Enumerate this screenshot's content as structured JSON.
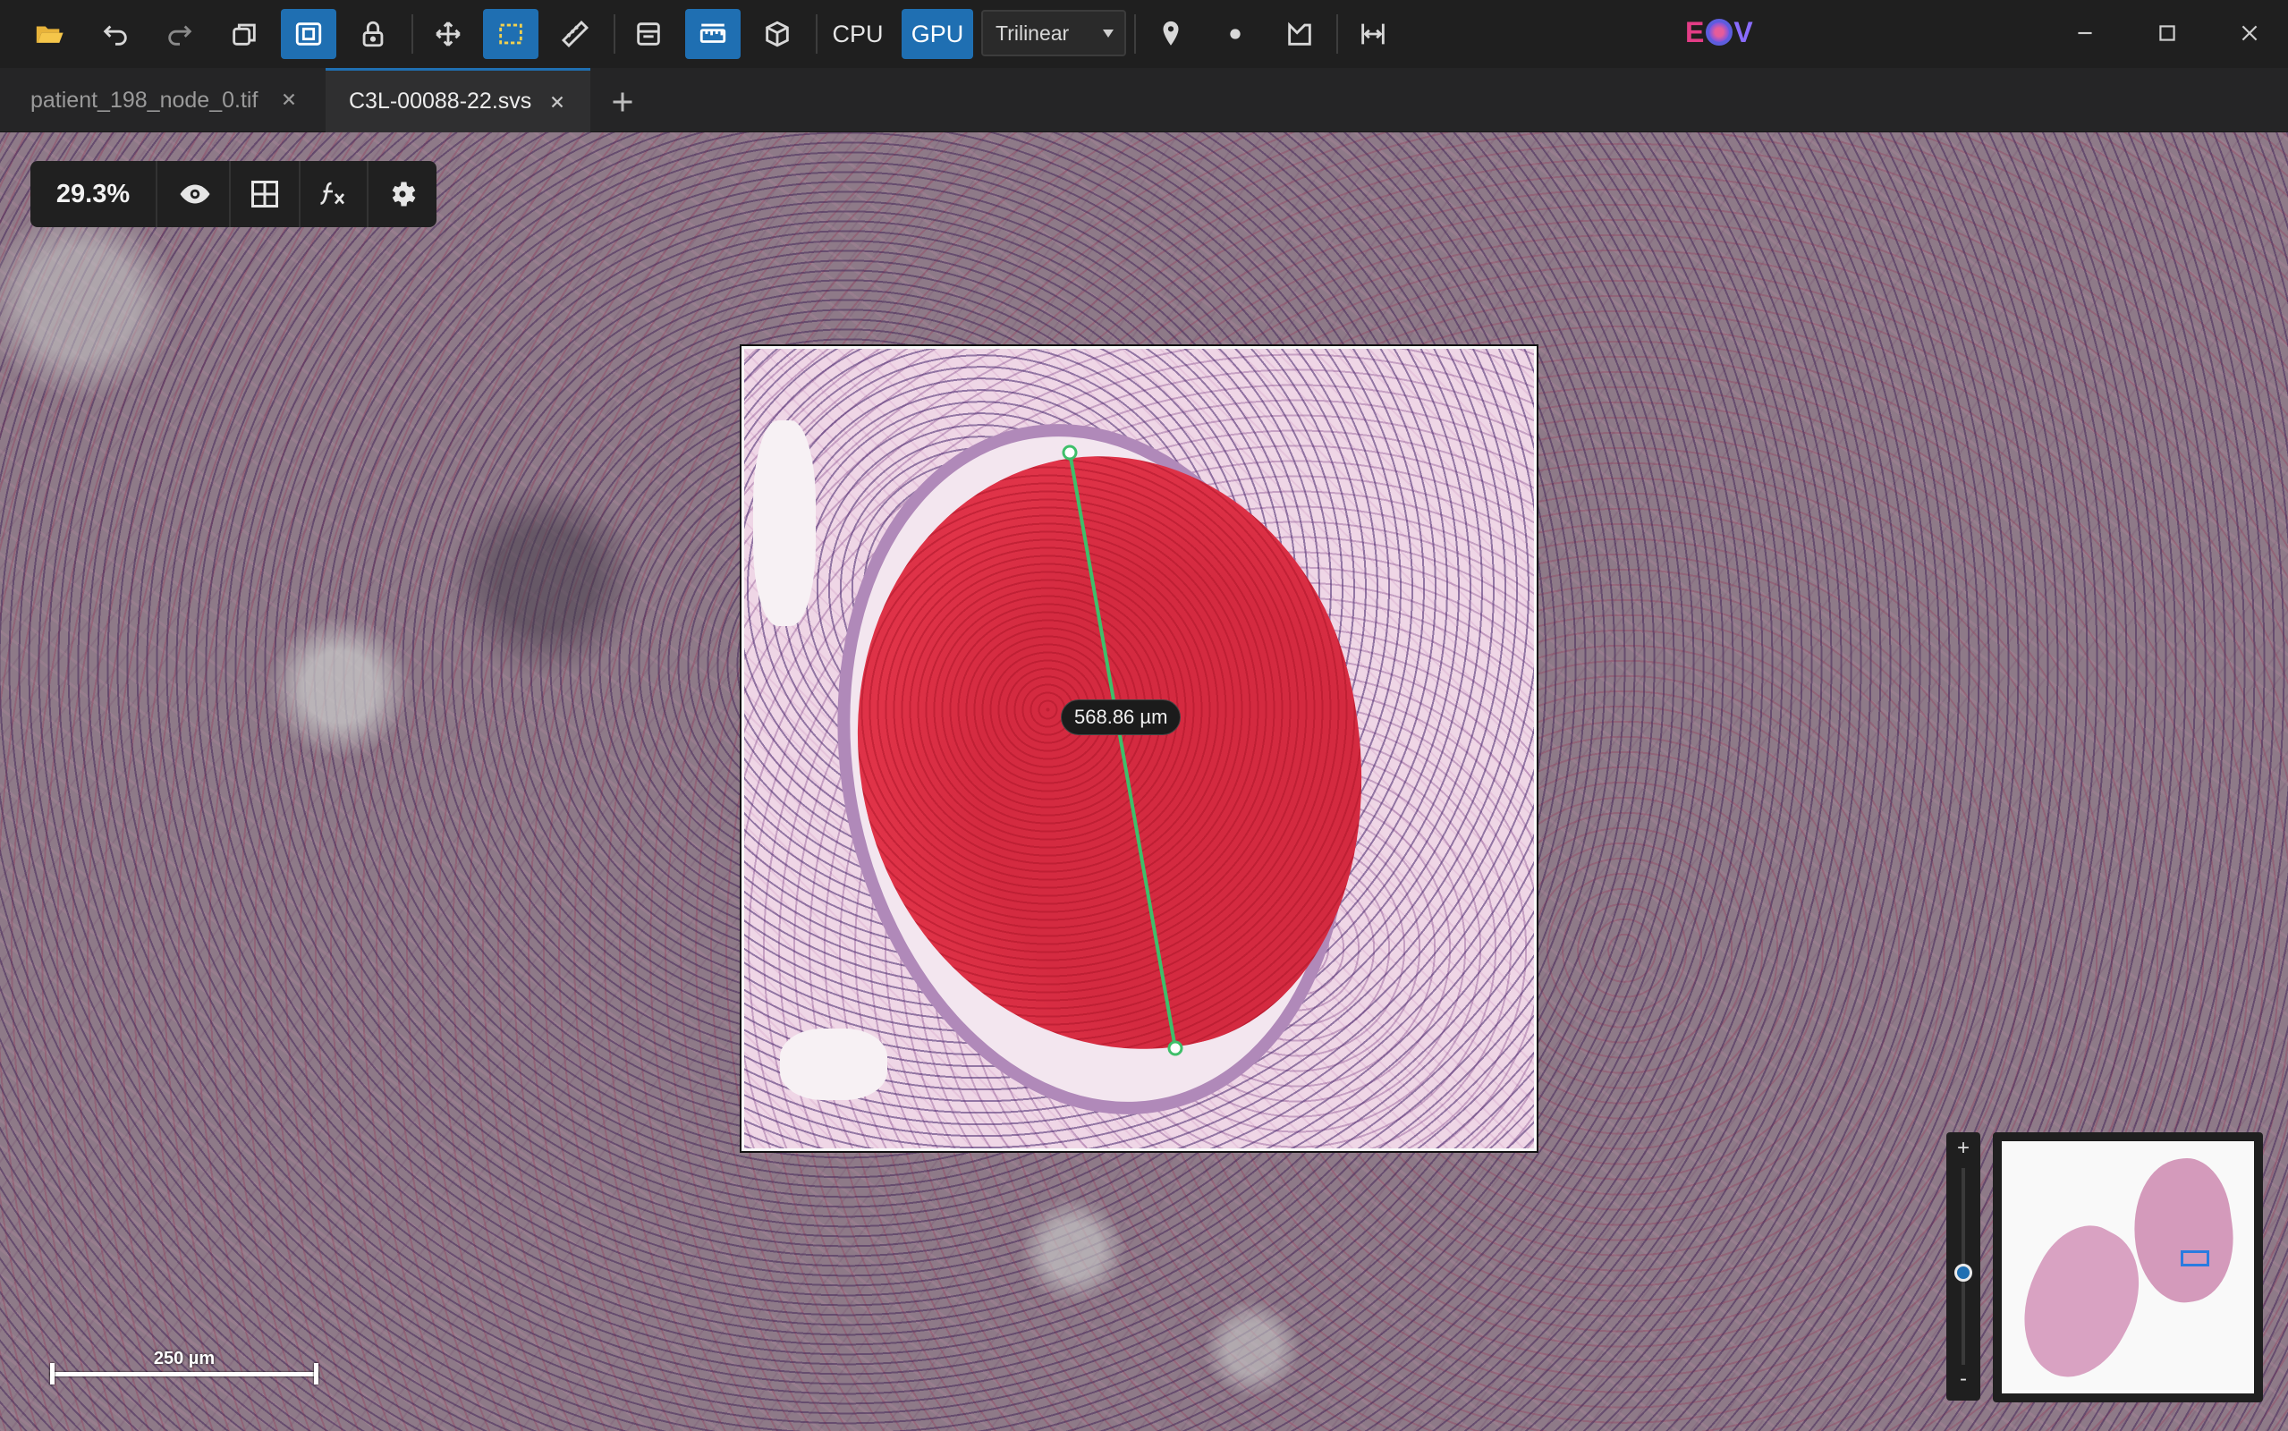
{
  "toolbar": {
    "icons": [
      "folder-open-icon",
      "undo-icon",
      "redo-icon",
      "layers-icon",
      "panel-toggle-icon",
      "lock-icon",
      "move-icon",
      "rectangle-select-icon",
      "ruler-icon",
      "annotation-panel-icon",
      "measure-window-icon",
      "cube-icon",
      "marker-pin-icon",
      "dot-icon",
      "polygon-icon",
      "compare-icon"
    ],
    "cpu_label": "CPU",
    "gpu_label": "GPU",
    "interpolation": "Trilinear",
    "active_color": "#1f6fb2"
  },
  "app": {
    "logo": "EOV"
  },
  "tabs": [
    {
      "label": "patient_198_node_0.tif",
      "active": false
    },
    {
      "label": "C3L-00088-22.svs",
      "active": true
    }
  ],
  "view_controls": {
    "zoom": "29.3%",
    "icons": [
      "eye-icon",
      "grid-icon",
      "function-icon",
      "gear-icon"
    ]
  },
  "measurement": {
    "label": "568.86 µm",
    "line_color": "#3fbf6a"
  },
  "scalebar": {
    "label": "250 µm"
  },
  "zoom_slider": {
    "plus": "+",
    "minus": "-",
    "level": 0.47
  }
}
